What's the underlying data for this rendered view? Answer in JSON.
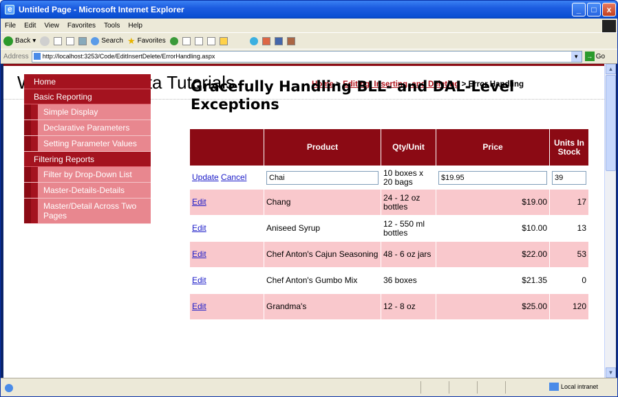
{
  "window": {
    "title": "Untitled Page - Microsoft Internet Explorer",
    "min": "_",
    "max": "□",
    "close": "x"
  },
  "menu": [
    "File",
    "Edit",
    "View",
    "Favorites",
    "Tools",
    "Help"
  ],
  "toolbar": {
    "back": "Back",
    "search": "Search",
    "favorites": "Favorites"
  },
  "address": {
    "label": "Address",
    "url": "http://localhost:3253/Code/EditInsertDelete/ErrorHandling.aspx",
    "go": "Go"
  },
  "status": {
    "zone": "Local intranet"
  },
  "page": {
    "site_title": "Working with Data Tutorials",
    "breadcrumb": {
      "home": "Home",
      "sep1": " > ",
      "section": "Editing, Inserting, and Deleting",
      "sep2": " > ",
      "current": "Error Handling"
    },
    "heading": "Gracefully Handling BLL- and DAL-Level Exceptions"
  },
  "sidebar": [
    {
      "label": "Home",
      "level": "main"
    },
    {
      "label": "Basic Reporting",
      "level": "main"
    },
    {
      "label": "Simple Display",
      "level": "sub"
    },
    {
      "label": "Declarative Parameters",
      "level": "sub"
    },
    {
      "label": "Setting Parameter Values",
      "level": "sub"
    },
    {
      "label": "Filtering Reports",
      "level": "main"
    },
    {
      "label": "Filter by Drop-Down List",
      "level": "sub"
    },
    {
      "label": "Master-Details-Details",
      "level": "sub"
    },
    {
      "label": "Master/Detail Across Two Pages",
      "level": "sub"
    }
  ],
  "grid": {
    "headers": [
      "",
      "Product",
      "Qty/Unit",
      "Price",
      "Units In Stock"
    ],
    "edit_row": {
      "update": "Update",
      "cancel": "Cancel",
      "product": "Chai",
      "qty": "10 boxes x 20 bags",
      "price": "$19.95",
      "stock": "39"
    },
    "edit_label": "Edit",
    "rows": [
      {
        "product": "Chang",
        "qty": "24 - 12 oz bottles",
        "price": "$19.00",
        "stock": "17"
      },
      {
        "product": "Aniseed Syrup",
        "qty": "12 - 550 ml bottles",
        "price": "$10.00",
        "stock": "13"
      },
      {
        "product": "Chef Anton's Cajun Seasoning",
        "qty": "48 - 6 oz jars",
        "price": "$22.00",
        "stock": "53"
      },
      {
        "product": "Chef Anton's Gumbo Mix",
        "qty": "36 boxes",
        "price": "$21.35",
        "stock": "0"
      },
      {
        "product": "Grandma's",
        "qty": "12 - 8 oz",
        "price": "$25.00",
        "stock": "120"
      }
    ]
  }
}
